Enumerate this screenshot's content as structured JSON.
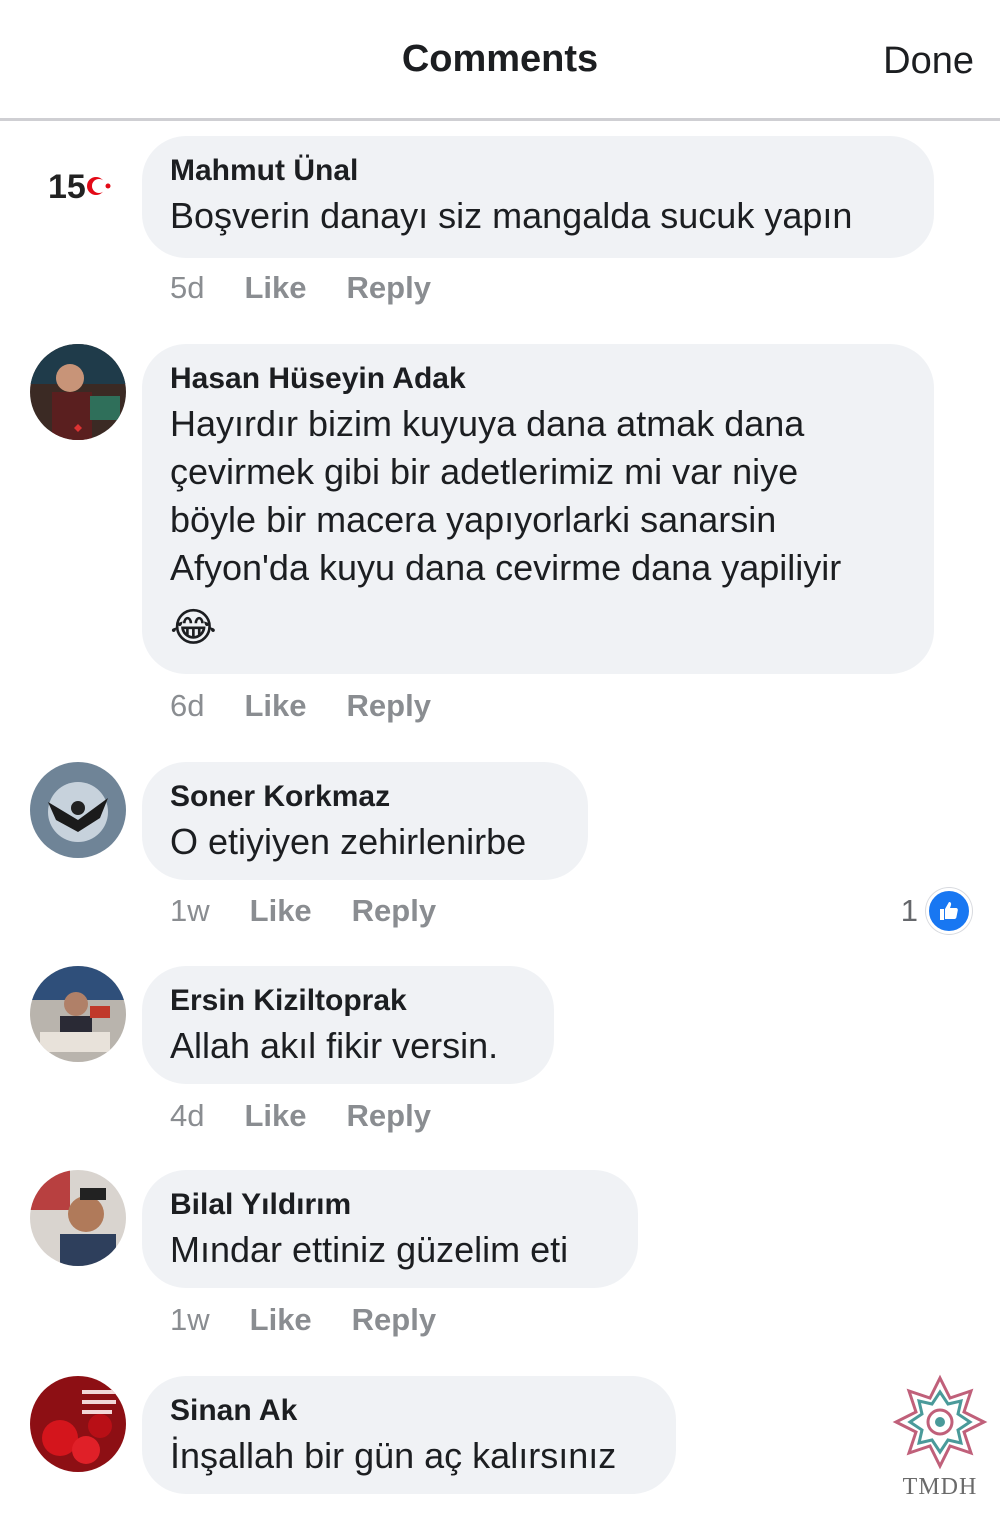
{
  "header": {
    "title": "Comments",
    "done_label": "Done"
  },
  "comments": [
    {
      "author": "Mahmut Ünal",
      "lines": [
        "Boşverin danayı siz mangalda sucuk yapın"
      ],
      "time": "5d",
      "like": "Like",
      "reply": "Reply"
    },
    {
      "author": "Hasan Hüseyin Adak",
      "lines": [
        "Hayırdır bizim kuyuya dana atmak dana",
        "çevirmek gibi bir adetlerimiz mi var  niye",
        "böyle bir macera yapıyorlarki sanarsin",
        "Afyon'da kuyu dana cevirme dana yapiliyir",
        "😂"
      ],
      "time": "6d",
      "like": "Like",
      "reply": "Reply"
    },
    {
      "author": "Soner Korkmaz",
      "lines": [
        "O etiyiyen zehirlenirbe"
      ],
      "time": "1w",
      "like": "Like",
      "reply": "Reply",
      "reaction_count": "1"
    },
    {
      "author": "Ersin Kiziltoprak",
      "lines": [
        "Allah akıl fikir versin."
      ],
      "time": "4d",
      "like": "Like",
      "reply": "Reply"
    },
    {
      "author": "Bilal Yıldırım",
      "lines": [
        "Mındar ettiniz güzelim eti"
      ],
      "time": "1w",
      "like": "Like",
      "reply": "Reply"
    },
    {
      "author": "Sinan Ak",
      "lines": [
        "İnşallah bir gün aç kalırsınız"
      ]
    }
  ],
  "avatar_icons": [
    "flag-15-icon",
    "user-photo-icon",
    "user-photo-icon",
    "user-photo-icon",
    "user-photo-icon",
    "roses-photo-icon"
  ],
  "colors": {
    "bubble": "#f0f2f5",
    "meta": "#8a8d91",
    "like_badge": "#1877f2"
  },
  "watermark": {
    "label": "TMDH"
  }
}
